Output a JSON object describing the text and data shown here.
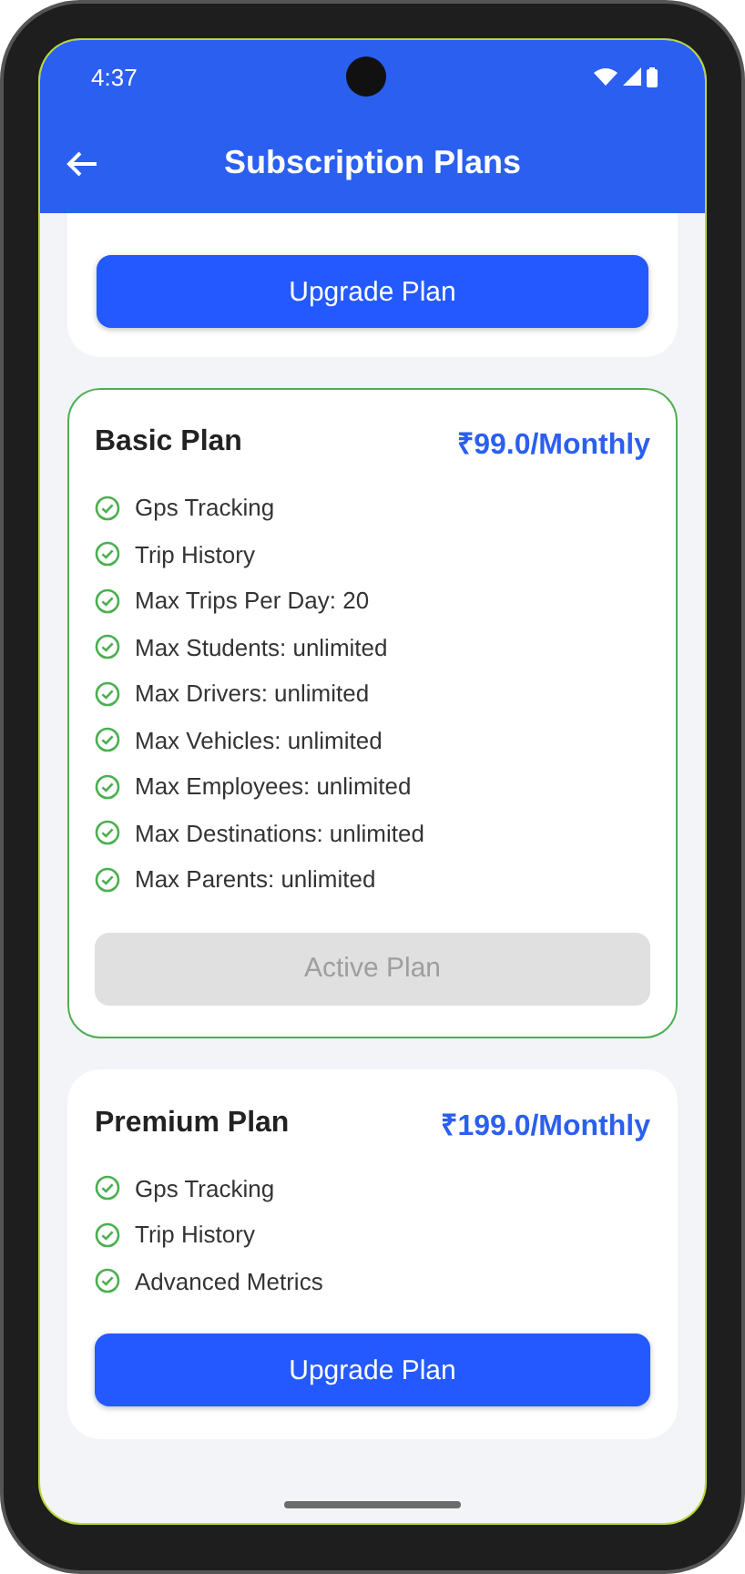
{
  "status_bar": {
    "time": "4:37"
  },
  "app_bar": {
    "title": "Subscription Plans"
  },
  "plans": [
    {
      "cut": true,
      "active": false,
      "button": {
        "label": "Upgrade Plan",
        "kind": "upgrade"
      }
    },
    {
      "cut": false,
      "active": true,
      "title": "Basic Plan",
      "price": "₹99.0/Monthly",
      "features": [
        "Gps Tracking",
        "Trip History",
        "Max Trips Per Day: 20",
        "Max Students: unlimited",
        "Max Drivers: unlimited",
        "Max Vehicles: unlimited",
        "Max Employees: unlimited",
        "Max Destinations: unlimited",
        "Max Parents: unlimited"
      ],
      "button": {
        "label": "Active Plan",
        "kind": "active"
      }
    },
    {
      "cut": false,
      "active": false,
      "title": "Premium Plan",
      "price": "₹199.0/Monthly",
      "features": [
        "Gps Tracking",
        "Trip History",
        "Advanced Metrics"
      ],
      "button": {
        "label": "Upgrade Plan",
        "kind": "upgrade"
      }
    }
  ]
}
